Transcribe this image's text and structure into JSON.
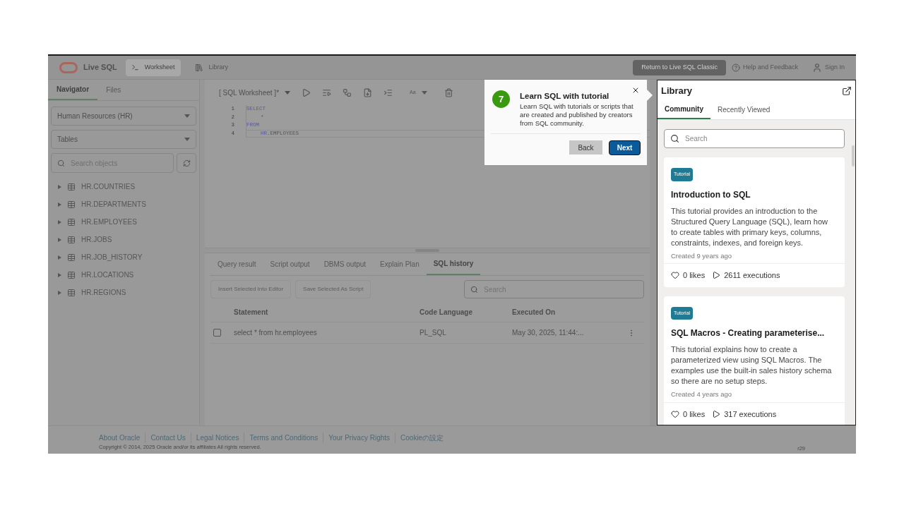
{
  "header": {
    "logo_text": "Live SQL",
    "nav": [
      {
        "label": "Worksheet",
        "selected": true,
        "kind": "terminal"
      },
      {
        "label": "Library",
        "selected": false,
        "kind": "library"
      }
    ],
    "classic_button": "Return to Live SQL Classic",
    "help": "Help and Feedback",
    "sign_in": "Sign In"
  },
  "navigator": {
    "tabs": [
      {
        "label": "Navigator",
        "selected": true
      },
      {
        "label": "Files",
        "selected": false
      }
    ],
    "schema_select": "Human Resources (HR)",
    "type_select": "Tables",
    "search": {
      "placeholder": "Search objects"
    },
    "tables": [
      {
        "name": "HR.COUNTRIES",
        "expanded": false
      },
      {
        "name": "HR.DEPARTMENTS",
        "expanded": false
      },
      {
        "name": "HR.EMPLOYEES",
        "expanded": false
      },
      {
        "name": "HR.JOBS",
        "expanded": false
      },
      {
        "name": "HR.JOB_HISTORY",
        "expanded": false
      },
      {
        "name": "HR.LOCATIONS",
        "expanded": false
      },
      {
        "name": "HR.REGIONS",
        "expanded": false
      }
    ]
  },
  "worksheet": {
    "title": "[ SQL Worksheet ]*",
    "font_button": "Aa",
    "lines": [
      {
        "number": "1",
        "indented": false,
        "current": false,
        "tokens": [
          {
            "text": "SELECT",
            "kind": "keyword"
          }
        ]
      },
      {
        "number": "2",
        "indented": true,
        "current": false,
        "tokens": [
          {
            "text": "*",
            "kind": "plain"
          }
        ]
      },
      {
        "number": "3",
        "indented": false,
        "current": false,
        "tokens": [
          {
            "text": "FROM",
            "kind": "keyword"
          }
        ]
      },
      {
        "number": "4",
        "indented": true,
        "current": true,
        "tokens": [
          {
            "text": "HR",
            "kind": "keyword"
          },
          {
            "text": ".EMPLOYEES",
            "kind": "plain"
          }
        ]
      }
    ]
  },
  "results": {
    "tabs": [
      {
        "label": "Query result",
        "selected": false
      },
      {
        "label": "Script output",
        "selected": false
      },
      {
        "label": "DBMS output",
        "selected": false
      },
      {
        "label": "Explain Plan",
        "selected": false
      },
      {
        "label": "SQL history",
        "selected": true
      }
    ],
    "buttons": [
      {
        "label": "Insert Selected Into Editor",
        "disabled": true
      },
      {
        "label": "Save Selected As Script",
        "disabled": true
      }
    ],
    "search": {
      "placeholder": "Search"
    },
    "columns": [
      "Statement",
      "Code Language",
      "Executed On"
    ],
    "rows": [
      {
        "checked": false,
        "statement": "select * from hr.employees",
        "language": "PL_SQL",
        "executed": "May 30, 2025, 11:44:..."
      }
    ]
  },
  "tour": {
    "step": "7",
    "title": "Learn SQL with tutorial",
    "body": "Learn SQL with tutorials or scripts that are created and published by creators from SQL community.",
    "back": "Back",
    "next": "Next"
  },
  "library": {
    "title": "Library",
    "tabs": [
      {
        "label": "Community",
        "selected": true
      },
      {
        "label": "Recently Viewed",
        "selected": false
      }
    ],
    "search": {
      "placeholder": "Search"
    },
    "cards": [
      {
        "tag": "Tutorial",
        "title": "Introduction to SQL",
        "description": "This tutorial provides an introduction to the Structured Query Language (SQL), learn how to create tables with primary keys, columns, constraints, indexes, and foreign keys.",
        "created": "Created 9 years ago",
        "likes": "0 likes",
        "executions": "2611 executions"
      },
      {
        "tag": "Tutorial",
        "title": "SQL Macros - Creating parameterise...",
        "description": "This tutorial explains how to create a parameterized view using SQL Macros. The examples use the built-in sales history schema so there are no setup steps.",
        "created": "Created 4 years ago",
        "likes": "0 likes",
        "executions": "317 executions"
      }
    ]
  },
  "footer": {
    "links": [
      "About Oracle",
      "Contact Us",
      "Legal Notices",
      "Terms and Conditions",
      "Your Privacy Rights",
      "Cookieの設定"
    ],
    "copyright": "Copyright © 2014, 2025 Oracle and/or its affiliates All rights reserved.",
    "version": "r29"
  }
}
